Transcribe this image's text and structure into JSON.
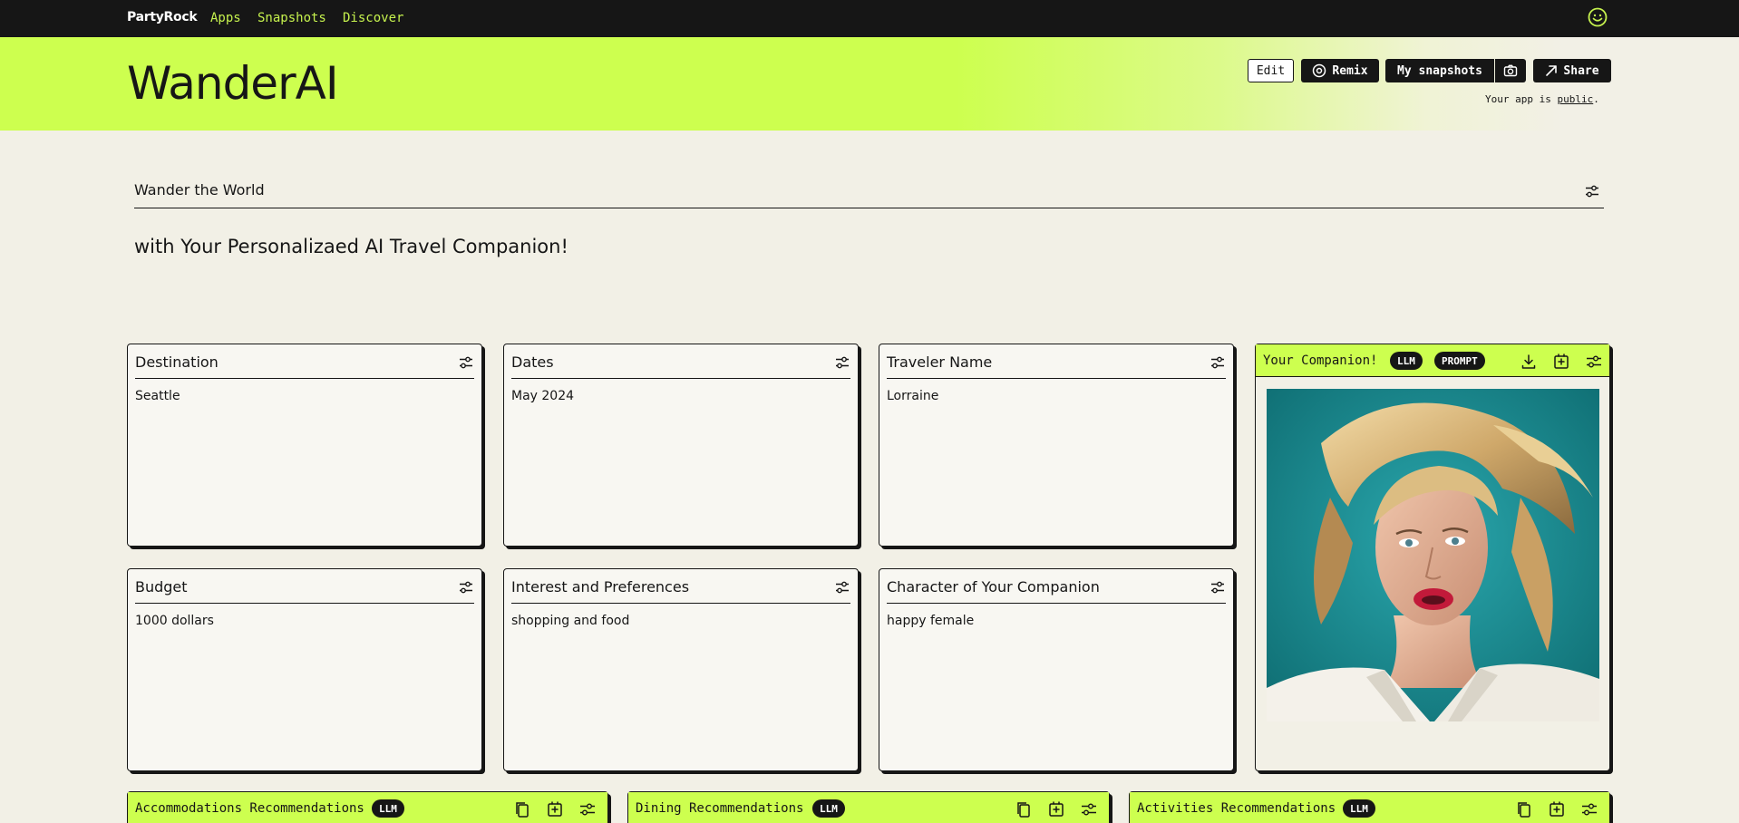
{
  "nav": {
    "brand": "PartyRock",
    "links": [
      "Apps",
      "Snapshots",
      "Discover"
    ]
  },
  "header": {
    "title": "WanderAI",
    "buttons": {
      "edit": "Edit",
      "remix": "Remix",
      "snapshots": "My snapshots",
      "share": "Share"
    },
    "public_prefix": "Your app is ",
    "public_link": "public",
    "public_suffix": "."
  },
  "hero": {
    "title": "Wander the World",
    "subtitle": "with Your Personalizaed AI Travel Companion!"
  },
  "inputs": [
    {
      "title": "Destination",
      "value": "Seattle"
    },
    {
      "title": "Dates",
      "value": "May 2024"
    },
    {
      "title": "Traveler Name",
      "value": "Lorraine"
    },
    {
      "title": "Budget",
      "value": "1000 dollars"
    },
    {
      "title": "Interest and Preferences",
      "value": "shopping and food"
    },
    {
      "title": "Character of Your Companion",
      "value": "happy female"
    }
  ],
  "companion": {
    "title": "Your Companion!",
    "badges": [
      "LLM",
      "PROMPT"
    ]
  },
  "widgets": [
    {
      "title": "Accommodations Recommendations",
      "badge": "LLM"
    },
    {
      "title": "Dining Recommendations",
      "badge": "LLM"
    },
    {
      "title": "Activities Recommendations",
      "badge": "LLM"
    }
  ],
  "colors": {
    "accent": "#cdff4f",
    "nav_bg": "#161616",
    "page_bg": "#f2f0e6",
    "link": "#c6f24e"
  }
}
